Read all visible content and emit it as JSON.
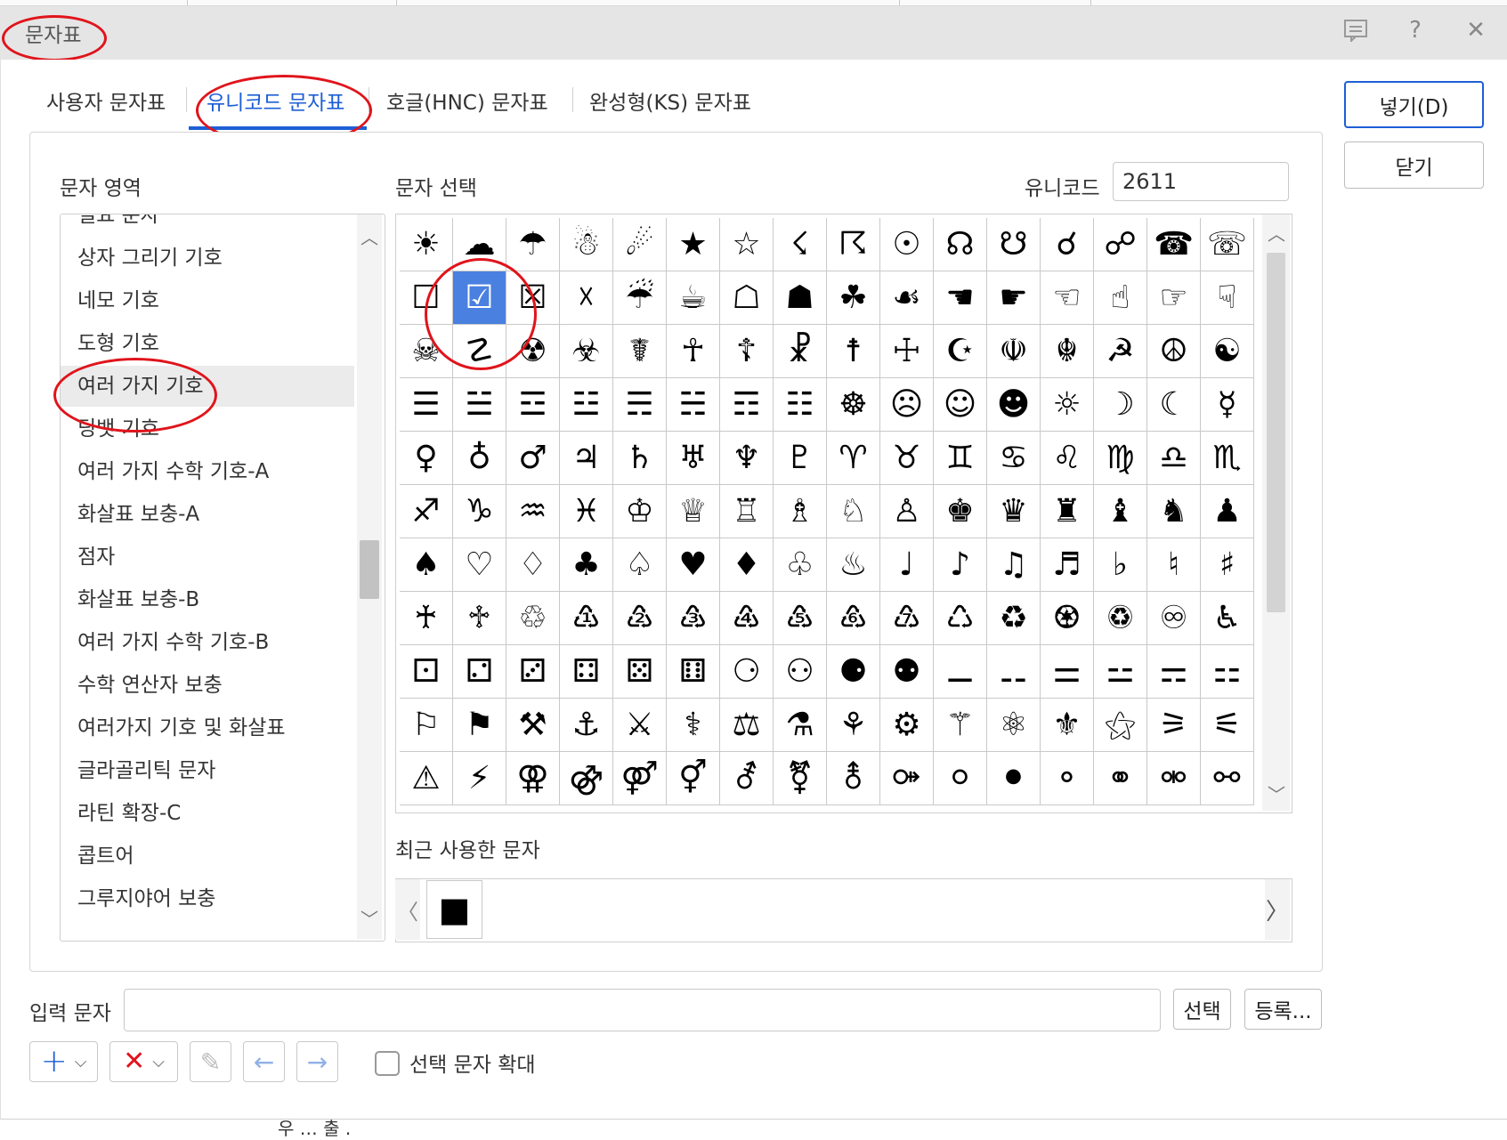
{
  "window": {
    "title": "문자표",
    "help_label": "?",
    "close_label": "✕"
  },
  "tabs": [
    {
      "label": "사용자 문자표"
    },
    {
      "label": "유니코드 문자표"
    },
    {
      "label": "호글(HNC) 문자표"
    },
    {
      "label": "완성형(KS) 문자표"
    }
  ],
  "labels": {
    "range": "문자 영역",
    "select": "문자 선택",
    "unicode": "유니코드",
    "recent": "최근 사용한 문자",
    "input": "입력 문자",
    "enlarge": "선택 문자 확대"
  },
  "unicode_value": "2611",
  "ranges": [
    "필요 문자",
    "상자 그리기 기호",
    "네모 기호",
    "도형 기호",
    "여러 가지 기호",
    "딩뱃 기호",
    "여러 가지 수학 기호-A",
    "화살표 보충-A",
    "점자",
    "화살표 보충-B",
    "여러 가지 수학 기호-B",
    "수학 연산자 보충",
    "여러가지 기호 및 화살표",
    "글라골리틱 문자",
    "라틴 확장-C",
    "콥트어",
    "그루지야어 보충"
  ],
  "selected_range": "여러 가지 기호",
  "grid": [
    [
      "☀",
      "☁",
      "☂",
      "☃",
      "☄",
      "★",
      "☆",
      "☇",
      "☈",
      "☉",
      "☊",
      "☋",
      "☌",
      "☍",
      "☎",
      "☏"
    ],
    [
      "☐",
      "☑",
      "☒",
      "☓",
      "☔",
      "☕",
      "☖",
      "☗",
      "☘",
      "☙",
      "☚",
      "☛",
      "☜",
      "☝",
      "☞",
      "☟"
    ],
    [
      "☠",
      "☡",
      "☢",
      "☣",
      "☤",
      "☥",
      "☦",
      "☧",
      "☨",
      "☩",
      "☪",
      "☫",
      "☬",
      "☭",
      "☮",
      "☯"
    ],
    [
      "☰",
      "☱",
      "☲",
      "☳",
      "☴",
      "☵",
      "☶",
      "☷",
      "☸",
      "☹",
      "☺",
      "☻",
      "☼",
      "☽",
      "☾",
      "☿"
    ],
    [
      "♀",
      "♁",
      "♂",
      "♃",
      "♄",
      "♅",
      "♆",
      "♇",
      "♈",
      "♉",
      "♊",
      "♋",
      "♌",
      "♍",
      "♎",
      "♏"
    ],
    [
      "♐",
      "♑",
      "♒",
      "♓",
      "♔",
      "♕",
      "♖",
      "♗",
      "♘",
      "♙",
      "♚",
      "♛",
      "♜",
      "♝",
      "♞",
      "♟"
    ],
    [
      "♠",
      "♡",
      "♢",
      "♣",
      "♤",
      "♥",
      "♦",
      "♧",
      "♨",
      "♩",
      "♪",
      "♫",
      "♬",
      "♭",
      "♮",
      "♯"
    ],
    [
      "♰",
      "♱",
      "♲",
      "♳",
      "♴",
      "♵",
      "♶",
      "♷",
      "♸",
      "♹",
      "♺",
      "♻",
      "♼",
      "♽",
      "♾",
      "♿"
    ],
    [
      "⚀",
      "⚁",
      "⚂",
      "⚃",
      "⚄",
      "⚅",
      "⚆",
      "⚇",
      "⚈",
      "⚉",
      "⚊",
      "⚋",
      "⚌",
      "⚍",
      "⚎",
      "⚏"
    ],
    [
      "⚐",
      "⚑",
      "⚒",
      "⚓",
      "⚔",
      "⚕",
      "⚖",
      "⚗",
      "⚘",
      "⚙",
      "⚚",
      "⚛",
      "⚜",
      "⚝",
      "⚞",
      "⚟"
    ],
    [
      "⚠",
      "⚡",
      "⚢",
      "⚣",
      "⚤",
      "⚥",
      "⚦",
      "⚧",
      "⚨",
      "⚩",
      "⚪",
      "⚫",
      "⚬",
      "⚭",
      "⚮",
      "⚯"
    ]
  ],
  "selected_char": "☑",
  "recent_chars": [
    "■"
  ],
  "recent_nav": {
    "prev": "〈",
    "next": "〉"
  },
  "buttons": {
    "insert": "넣기(D)",
    "close": "닫기",
    "select": "선택",
    "register": "등록..."
  },
  "input_value": "",
  "toolbar": {
    "add": "+",
    "remove": "✕",
    "edit": "✎",
    "left": "←",
    "right": "→",
    "dropdown": "⌵"
  },
  "enlarge_checked": false,
  "colors": {
    "accent": "#1d5fd6",
    "selection": "#4a80e0",
    "annotation": "#e0141b"
  },
  "bottom_text": "우 …  출 ."
}
